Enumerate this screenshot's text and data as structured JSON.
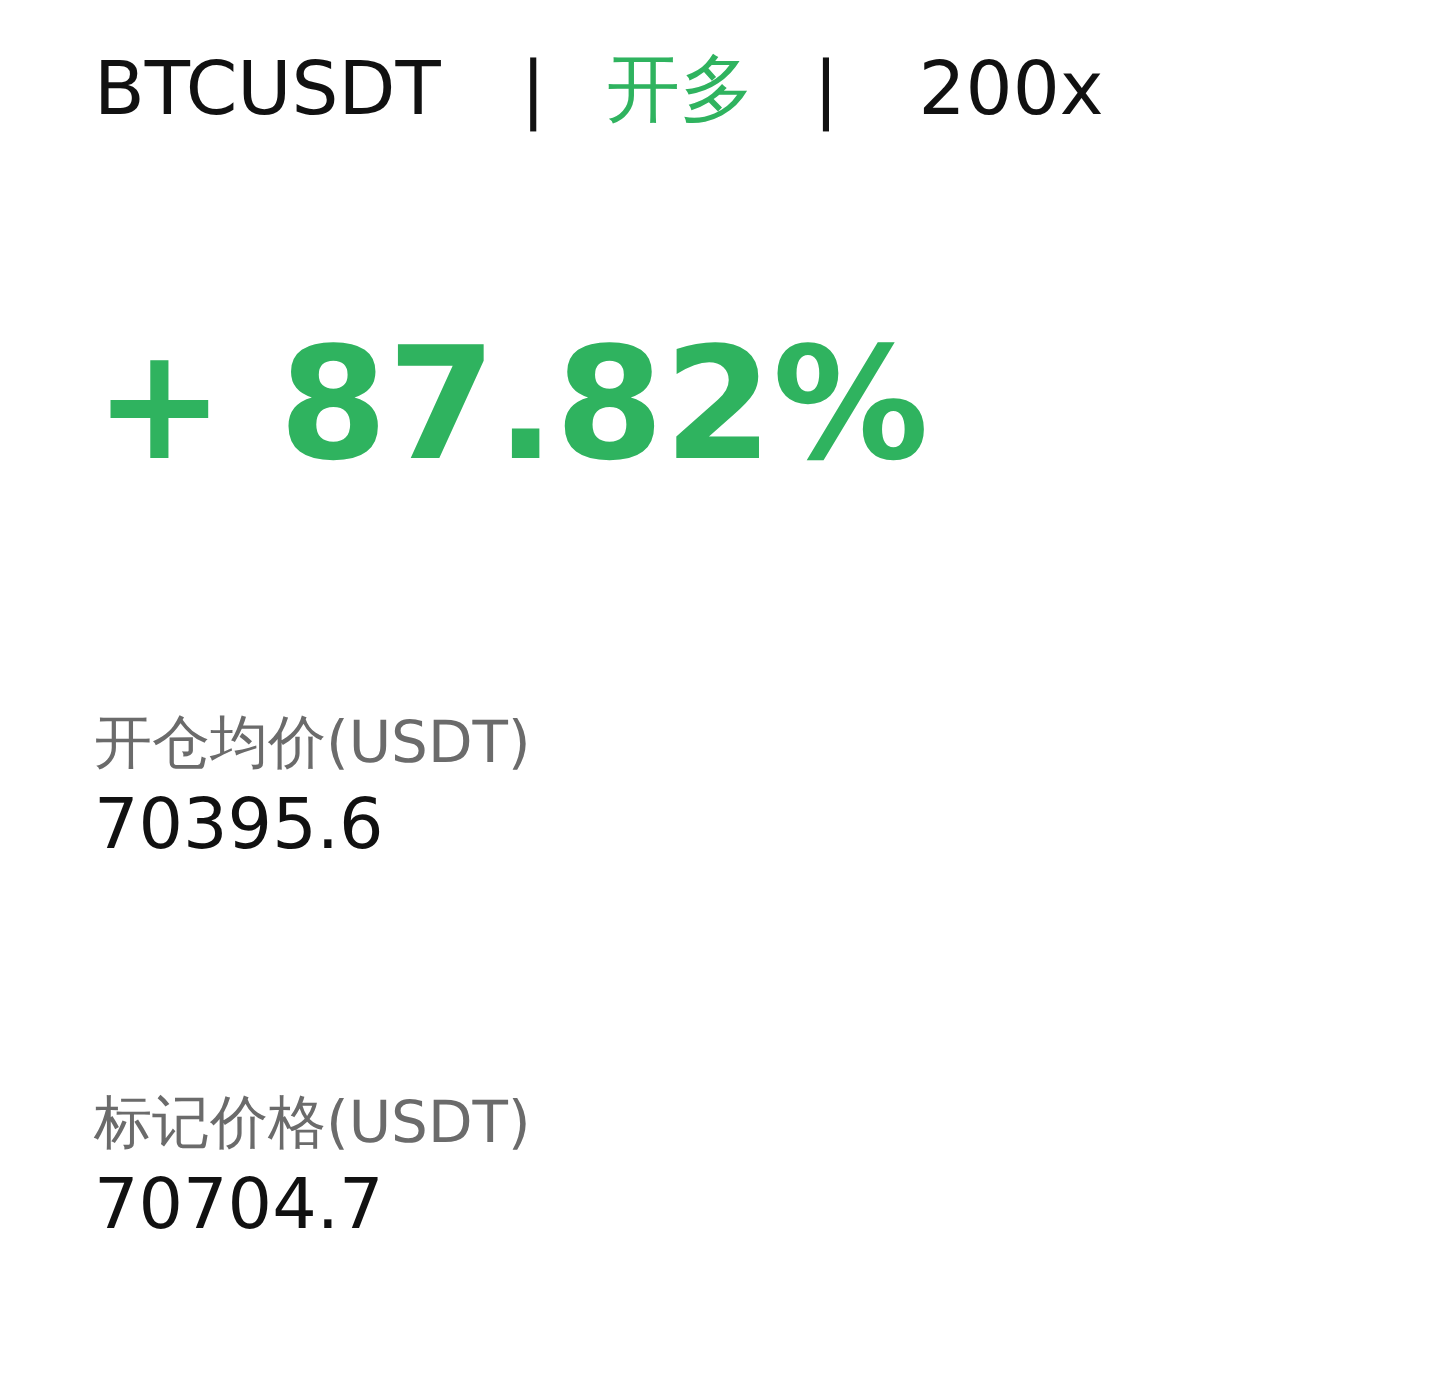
{
  "symbol": "BTCUSDT",
  "separator_1": "|",
  "side": "开多",
  "separator_2": "|",
  "leverage": "200x",
  "pnl_percent": "+ 87.82%",
  "fields": [
    {
      "label": "开仓均价(USDT)",
      "value": "70395.6"
    },
    {
      "label": "标记价格(USDT)",
      "value": "70704.7"
    }
  ]
}
